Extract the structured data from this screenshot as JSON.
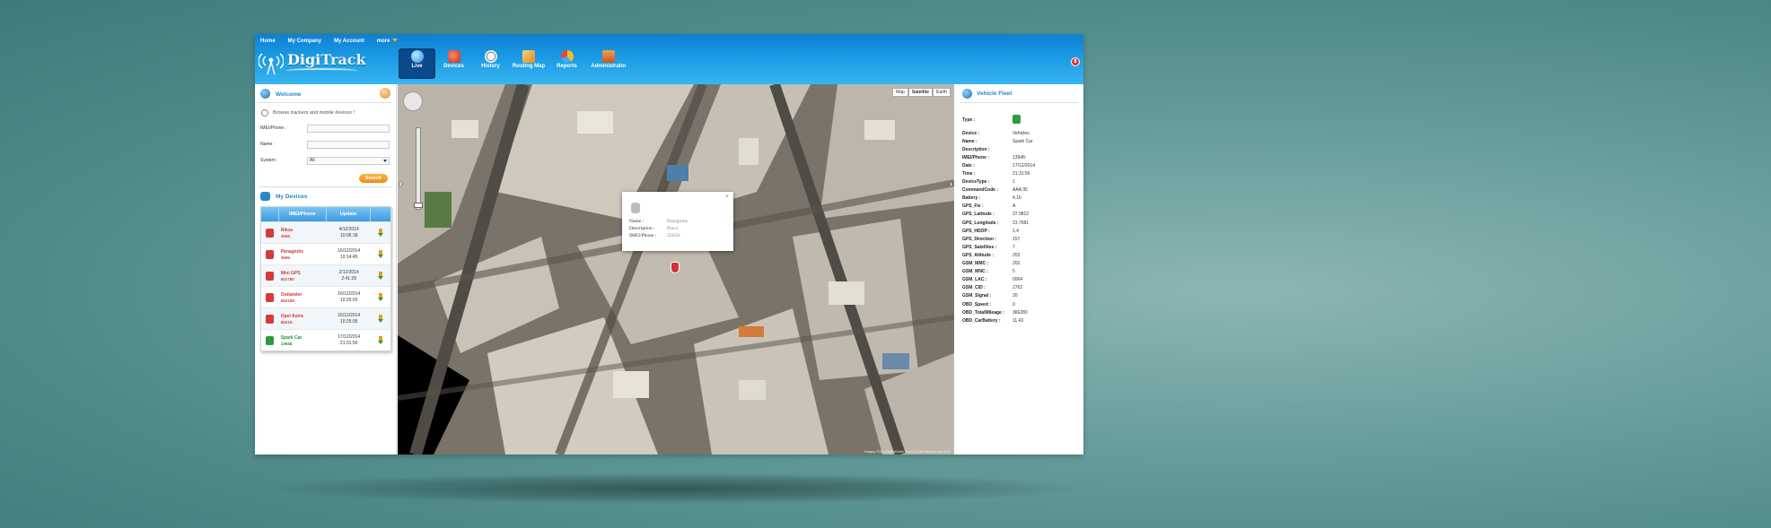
{
  "topnav": {
    "home": "Home",
    "company": "My Company",
    "account": "My Account",
    "more": "more"
  },
  "logo": {
    "part1": "Digi",
    "part2": "Track"
  },
  "mainnav": [
    {
      "label": "Live",
      "icon": "globe-icon",
      "color": "#3aa8ef"
    },
    {
      "label": "Devices",
      "icon": "car-icon",
      "color": "#e24a3a"
    },
    {
      "label": "History",
      "icon": "clock-icon",
      "color": "#f2f2f2"
    },
    {
      "label": "Routing Map",
      "icon": "map-icon",
      "color": "#f0b040"
    },
    {
      "label": "Reports",
      "icon": "pie-chart-icon",
      "color": "#f0c030"
    },
    {
      "label": "Administrator",
      "icon": "admin-icon",
      "color": "#e07a30"
    }
  ],
  "left": {
    "welcome": "Welcome",
    "browse": "Browse trackers and mobile devices !",
    "imei_label": "IMEI/Phone :",
    "imei_value": "",
    "name_label": "Name :",
    "name_value": "",
    "system_label": "System :",
    "system_value": "All",
    "search_btn": "Search",
    "my_devices": "My Devices",
    "table_headers": {
      "imei": "IMEI/Phone",
      "update": "Update"
    },
    "devices": [
      {
        "name": "Nikos",
        "imei": "3565:",
        "date": "4/12/2014",
        "time": "10:05:18",
        "status": "red"
      },
      {
        "name": "Panagiotis",
        "imei": "3565:",
        "date": "16/12/2014",
        "time": "10:14:45",
        "status": "red"
      },
      {
        "name": "Mini GPS",
        "imei": "601780",
        "date": "2/12/2014",
        "time": "2:41:29",
        "status": "red"
      },
      {
        "name": "Outlander",
        "imei": "852159:",
        "date": "16/12/2014",
        "time": "10:25:02",
        "status": "red"
      },
      {
        "name": "Opel Astra",
        "imei": "85215:",
        "date": "16/12/2014",
        "time": "10:25:05",
        "status": "red"
      },
      {
        "name": "Spark Car",
        "imei": "13946:",
        "date": "17/12/2014",
        "time": "21:31:56",
        "status": "green"
      }
    ]
  },
  "map": {
    "types": [
      "Map",
      "Satellite",
      "Earth"
    ],
    "info": {
      "name_label": "Name :",
      "name_value": "Panagiotis",
      "desc_label": "Description :",
      "desc_value": "Pinco",
      "imei_label": "IMEI/Phone :",
      "imei_value": "35650:"
    },
    "attribution": "Imagery ©2014 DigitalGlobe  Terms of Use  Report a map error"
  },
  "right": {
    "title": "Vehicle Fleet",
    "props": [
      {
        "k": "Type :",
        "v": ""
      },
      {
        "k": "Device :",
        "v": "Vehicles"
      },
      {
        "k": "Name :",
        "v": "Spark Car"
      },
      {
        "k": "Description :",
        "v": ""
      },
      {
        "k": "IMEI/Phone :",
        "v": "13946:"
      },
      {
        "k": "Date :",
        "v": "17/12/2014"
      },
      {
        "k": "Time :",
        "v": "21:31:56"
      },
      {
        "k": "DeviceType :",
        "v": "1"
      },
      {
        "k": "CommandCode :",
        "v": "AAA:35"
      },
      {
        "k": "Battery :",
        "v": "4.16"
      },
      {
        "k": "GPS_Fix :",
        "v": "A"
      },
      {
        "k": "GPS_Latitude :",
        "v": "37.9812"
      },
      {
        "k": "GPS_Longitude :",
        "v": "23.7681"
      },
      {
        "k": "GPS_HDOP :",
        "v": "1.4"
      },
      {
        "k": "GPS_Direction :",
        "v": "157"
      },
      {
        "k": "GPS_Satellites :",
        "v": "7"
      },
      {
        "k": "GPS_Altitude :",
        "v": "203"
      },
      {
        "k": "GSM_MMC :",
        "v": "202"
      },
      {
        "k": "GSM_MNC :",
        "v": "5"
      },
      {
        "k": "GSM_LAC :",
        "v": "0064"
      },
      {
        "k": "GSM_CID :",
        "v": "2762"
      },
      {
        "k": "GSM_Signal :",
        "v": "20"
      },
      {
        "k": "OBD_Speed :",
        "v": "0"
      },
      {
        "k": "OBD_TotalMileage :",
        "v": "366280"
      },
      {
        "k": "OBD_CarBattery :",
        "v": "11.43"
      }
    ]
  }
}
